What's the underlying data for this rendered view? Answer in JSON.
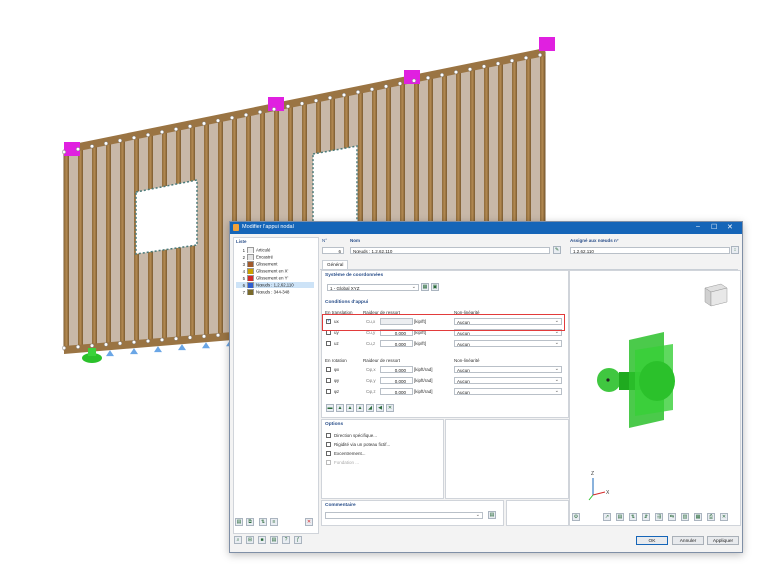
{
  "dialog": {
    "title": "Modifier l'appui nodal",
    "window_controls": [
      "–",
      "☐",
      "✕"
    ]
  },
  "list": {
    "label": "Liste",
    "items": [
      {
        "no": "1",
        "text": "Articulé",
        "color": "#f0f0f0"
      },
      {
        "no": "2",
        "text": "Encastré",
        "color": "#e5e5e5"
      },
      {
        "no": "3",
        "text": "Glissement",
        "color": "#a05a2c"
      },
      {
        "no": "4",
        "text": "Glissement en X'",
        "color": "#c9a100"
      },
      {
        "no": "5",
        "text": "Glissement en Y'",
        "color": "#d42a2a"
      },
      {
        "no": "6",
        "text": "Nœuds : 1,2,62,110",
        "color": "#2f5fd0"
      },
      {
        "no": "7",
        "text": "Nœuds : 344-348",
        "color": "#7a6a2a"
      }
    ]
  },
  "header": {
    "no_label": "N°",
    "no_value": "6",
    "name_label": "Nom",
    "name_value": "Nœuds : 1,2,62,110",
    "assigned_label": "Assigné aux nœuds n°",
    "assigned_value": "1,2,62,110"
  },
  "tabs": [
    "Général"
  ],
  "coord": {
    "label": "Système de coordonnées",
    "value": "1 - Global XYZ"
  },
  "conditions": {
    "label": "Conditions d'appui",
    "translation_label": "En translation",
    "spring_label": "Raideur de ressort",
    "nonlin_label": "Non-linéarité",
    "translation_rows": [
      {
        "axis": "ux",
        "c": "Cu,x",
        "value": "",
        "unit": "[kip/ft]",
        "nonlin": "Aucun",
        "checked": true
      },
      {
        "axis": "uy",
        "c": "Cu,y",
        "value": "0.000",
        "unit": "[kip/ft]",
        "nonlin": "Aucun",
        "checked": false
      },
      {
        "axis": "uz",
        "c": "Cu,z",
        "value": "0.000",
        "unit": "[kip/ft]",
        "nonlin": "Aucun",
        "checked": false
      }
    ],
    "rotation_label": "En rotation",
    "rotation_rows": [
      {
        "axis": "φx",
        "c": "Cφ,x",
        "value": "0.000",
        "unit": "[kipft/rad]",
        "nonlin": "Aucun",
        "checked": false
      },
      {
        "axis": "φy",
        "c": "Cφ,y",
        "value": "0.000",
        "unit": "[kipft/rad]",
        "nonlin": "Aucun",
        "checked": false
      },
      {
        "axis": "φz",
        "c": "Cφ,z",
        "value": "0.000",
        "unit": "[kipft/rad]",
        "nonlin": "Aucun",
        "checked": false
      }
    ]
  },
  "options": {
    "label": "Options",
    "items": [
      {
        "text": "Direction spécifique...",
        "enabled": true
      },
      {
        "text": "Rigidité via un poteau fictif...",
        "enabled": true
      },
      {
        "text": "Excentrement...",
        "enabled": true
      },
      {
        "text": "Fondation ...",
        "enabled": false
      }
    ]
  },
  "comment": {
    "label": "Commentaire"
  },
  "buttons": {
    "ok": "OK",
    "cancel": "Annuler",
    "apply": "Appliquer"
  },
  "preview": {
    "axis_x": "X",
    "axis_z": "Z",
    "support_color": "#2bc12b"
  },
  "colors": {
    "accent": "#1565b8",
    "highlight": "#e23b3b"
  }
}
